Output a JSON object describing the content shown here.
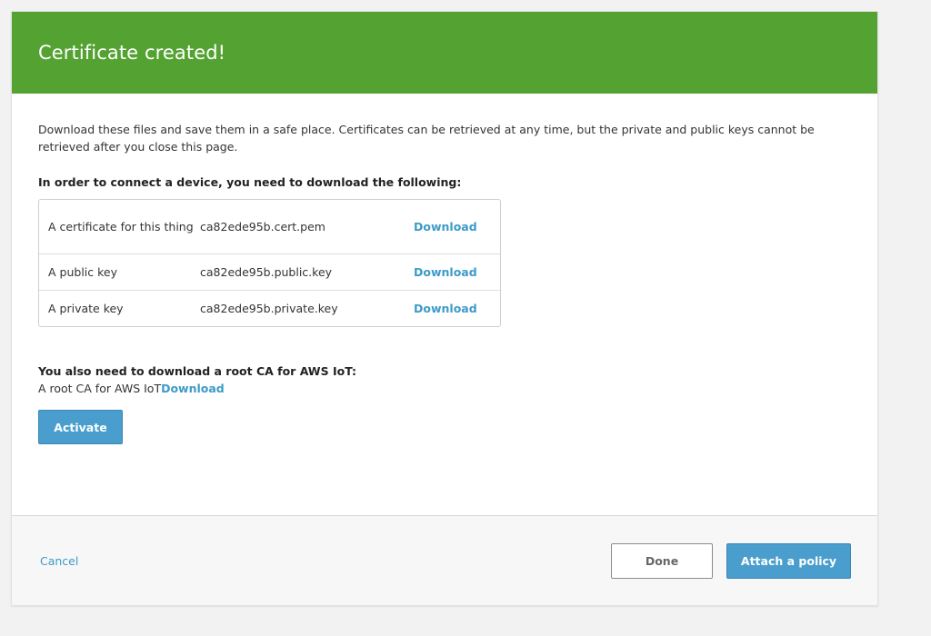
{
  "header": {
    "title": "Certificate created!"
  },
  "intro": "Download these files and save them in a safe place. Certificates can be retrieved at any time, but the private and public keys cannot be retrieved after you close this page.",
  "requirements_title": "In order to connect a device, you need to download the following:",
  "files": [
    {
      "description": "A certificate for this thing",
      "filename": "ca82ede95b.cert.pem",
      "action": "Download"
    },
    {
      "description": "A public key",
      "filename": "ca82ede95b.public.key",
      "action": "Download"
    },
    {
      "description": "A private key",
      "filename": "ca82ede95b.private.key",
      "action": "Download"
    }
  ],
  "root_ca": {
    "title": "You also need to download a root CA for AWS IoT:",
    "label": "A root CA for AWS IoT",
    "action": "Download"
  },
  "buttons": {
    "activate": "Activate",
    "cancel": "Cancel",
    "done": "Done",
    "attach_policy": "Attach a policy"
  },
  "colors": {
    "header_green": "#54a332",
    "link_blue": "#3d9bc8",
    "primary_button": "#4a9ecd"
  }
}
